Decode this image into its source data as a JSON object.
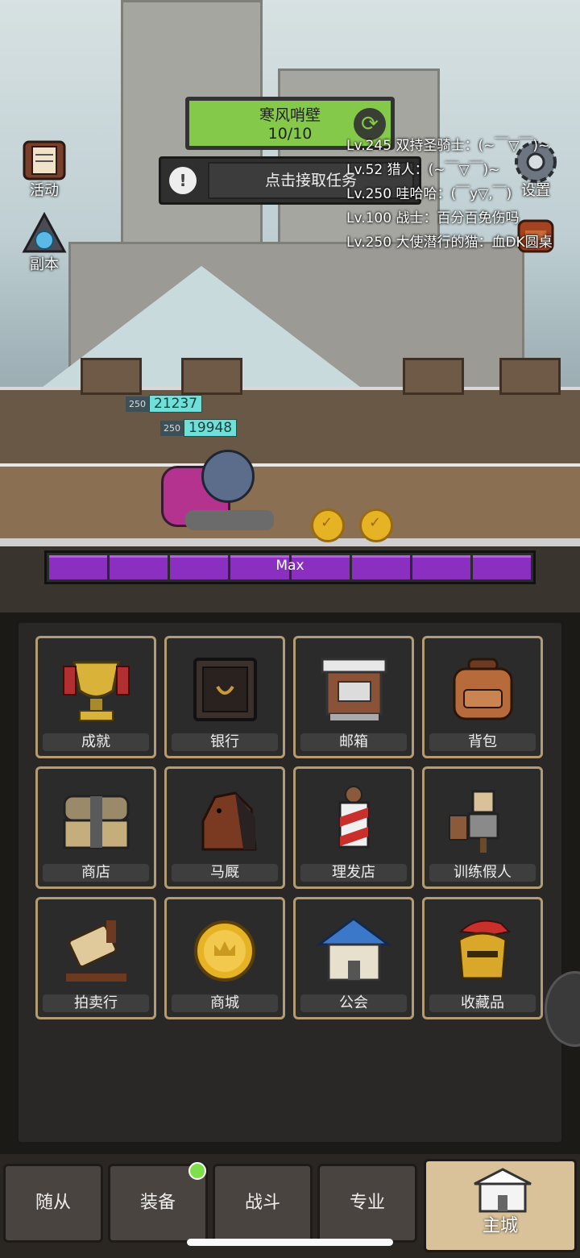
{
  "side_left": [
    {
      "label": "活动",
      "icon": "scroll-book-icon"
    },
    {
      "label": "副本",
      "icon": "portal-icon"
    }
  ],
  "side_right": [
    {
      "label": "设置",
      "icon": "gear-icon"
    },
    {
      "label": "",
      "icon": "backpack-icon"
    }
  ],
  "task": {
    "title": "寒风哨壁",
    "progress": "10/10"
  },
  "quest": {
    "label": "点击接取任务"
  },
  "chat": [
    "Lv.245 双持圣骑士：(~￣▽￣)~",
    "Lv.52 猎人：(~￣▽￣)~",
    "Lv.250 哇哈哈：(￣y▽,￣)",
    "Lv.100 战士：百分百免伤吗",
    "Lv.250 大使潜行的猫：血DK圆桌"
  ],
  "hp_bars": [
    {
      "level": "250",
      "value": "21237"
    },
    {
      "level": "250",
      "value": "19948"
    }
  ],
  "max_bar": {
    "label": "Max",
    "fill": 1.0
  },
  "tiles": [
    {
      "label": "成就",
      "icon": "trophy-icon"
    },
    {
      "label": "银行",
      "icon": "vault-icon"
    },
    {
      "label": "邮箱",
      "icon": "mailbox-icon"
    },
    {
      "label": "背包",
      "icon": "backpack-icon"
    },
    {
      "label": "商店",
      "icon": "chest-icon"
    },
    {
      "label": "马厩",
      "icon": "horse-icon"
    },
    {
      "label": "理发店",
      "icon": "barber-pole-icon"
    },
    {
      "label": "训练假人",
      "icon": "training-dummy-icon"
    },
    {
      "label": "拍卖行",
      "icon": "gavel-icon"
    },
    {
      "label": "商城",
      "icon": "gold-coin-icon"
    },
    {
      "label": "公会",
      "icon": "guild-house-icon"
    },
    {
      "label": "收藏品",
      "icon": "helmet-icon"
    }
  ],
  "tabs": [
    {
      "label": "随从"
    },
    {
      "label": "装备"
    },
    {
      "label": "战斗"
    },
    {
      "label": "专业"
    },
    {
      "label": "主城"
    }
  ],
  "colors": {
    "task_green": "#85c94a",
    "hp_teal": "#6fe0d9",
    "energy_purple": "#8a2fc0",
    "tile_border": "#b49b73"
  }
}
